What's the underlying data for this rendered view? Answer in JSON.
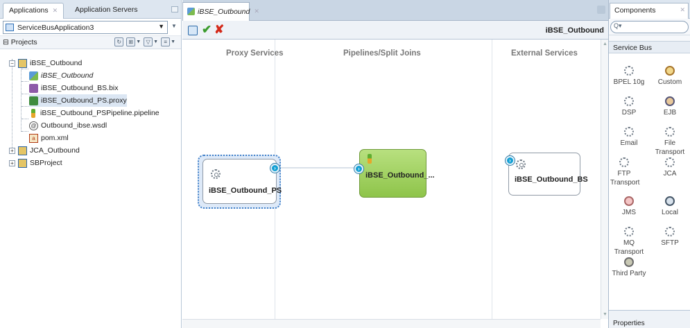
{
  "left_panel": {
    "tabs": [
      "Applications",
      "Application Servers"
    ],
    "application": "ServiceBusApplication3",
    "projects_label": "Projects",
    "tree": [
      {
        "label": "iBSE_Outbound",
        "type": "project",
        "level": 0,
        "expanded": true
      },
      {
        "label": "iBSE_Outbound",
        "type": "flow",
        "level": 1,
        "italic": true
      },
      {
        "label": "iBSE_Outbound_BS.bix",
        "type": "business",
        "level": 1
      },
      {
        "label": "iBSE_Outbound_PS.proxy",
        "type": "proxy",
        "level": 1,
        "selected": true
      },
      {
        "label": "iBSE_Outbound_PSPipeline.pipeline",
        "type": "pipeline",
        "level": 1
      },
      {
        "label": "Outbound_ibse.wsdl",
        "type": "wsdl",
        "level": 1
      },
      {
        "label": "pom.xml",
        "type": "xml",
        "level": 1
      },
      {
        "label": "JCA_Outbound",
        "type": "project",
        "level": 0,
        "expanded": false
      },
      {
        "label": "SBProject",
        "type": "project",
        "level": 0,
        "expanded": false
      }
    ]
  },
  "editor": {
    "tab_label": "iBSE_Outbound",
    "title": "iBSE_Outbound",
    "columns": [
      "Proxy Services",
      "Pipelines/Split Joins",
      "External Services"
    ],
    "components": {
      "proxy": "iBSE_Outbound_PS",
      "pipeline": "iBSE_Outbound_...",
      "business": "iBSE_Outbound_BS"
    }
  },
  "right_panel": {
    "tab_label": "Components",
    "category": "Service Bus",
    "items": [
      {
        "label": "BPEL 10g",
        "icon": "gear-icon"
      },
      {
        "label": "Custom",
        "icon": "custom-icon"
      },
      {
        "label": "DSP",
        "icon": "gear-icon"
      },
      {
        "label": "EJB",
        "icon": "ejb-icon"
      },
      {
        "label": "Email",
        "icon": "gear-icon"
      },
      {
        "label": "File Transport",
        "icon": "gear-icon"
      },
      {
        "label": "FTP Transport",
        "icon": "gear-icon"
      },
      {
        "label": "JCA",
        "icon": "gear-icon"
      },
      {
        "label": "JMS",
        "icon": "jms-icon"
      },
      {
        "label": "Local",
        "icon": "local-icon"
      },
      {
        "label": "MQ Transport",
        "icon": "gear-icon"
      },
      {
        "label": "SFTP",
        "icon": "gear-icon"
      },
      {
        "label": "Third Party",
        "icon": "thirdparty-icon"
      }
    ],
    "bottom_label": "Properties"
  }
}
